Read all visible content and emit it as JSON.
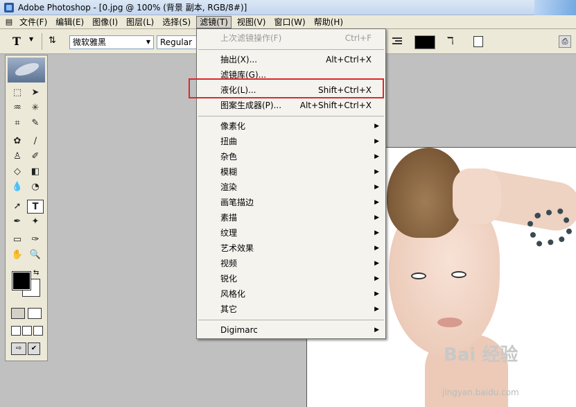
{
  "window": {
    "title": "Adobe Photoshop - [0.jpg @ 100% (背景 副本, RGB/8#)]"
  },
  "menubar": {
    "items": [
      "文件(F)",
      "编辑(E)",
      "图像(I)",
      "图层(L)",
      "选择(S)",
      "滤镜(T)",
      "视图(V)",
      "窗口(W)",
      "帮助(H)"
    ],
    "active_index": 5
  },
  "options": {
    "tool_glyph": "T",
    "font_family_value": "微软雅黑",
    "font_style_value": "Regular",
    "text_color": "#000000"
  },
  "filter_menu": {
    "items": [
      {
        "label": "上次滤镜操作(F)",
        "shortcut": "Ctrl+F",
        "disabled": true
      },
      {
        "label": "抽出(X)...",
        "shortcut": "Alt+Ctrl+X"
      },
      {
        "label": "滤镜库(G)...",
        "shortcut": ""
      },
      {
        "label": "液化(L)...",
        "shortcut": "Shift+Ctrl+X",
        "highlighted": true
      },
      {
        "label": "图案生成器(P)...",
        "shortcut": "Alt+Shift+Ctrl+X"
      },
      {
        "label": "像素化",
        "submenu": true
      },
      {
        "label": "扭曲",
        "submenu": true
      },
      {
        "label": "杂色",
        "submenu": true
      },
      {
        "label": "模糊",
        "submenu": true
      },
      {
        "label": "渲染",
        "submenu": true
      },
      {
        "label": "画笔描边",
        "submenu": true
      },
      {
        "label": "素描",
        "submenu": true
      },
      {
        "label": "纹理",
        "submenu": true
      },
      {
        "label": "艺术效果",
        "submenu": true
      },
      {
        "label": "视频",
        "submenu": true
      },
      {
        "label": "锐化",
        "submenu": true
      },
      {
        "label": "风格化",
        "submenu": true
      },
      {
        "label": "其它",
        "submenu": true
      },
      {
        "label": "Digimarc",
        "submenu": true
      }
    ],
    "highlight_color": "#e0262b"
  },
  "watermark": {
    "brand": "Bai 经验",
    "url": "jingyan.baidu.com"
  }
}
